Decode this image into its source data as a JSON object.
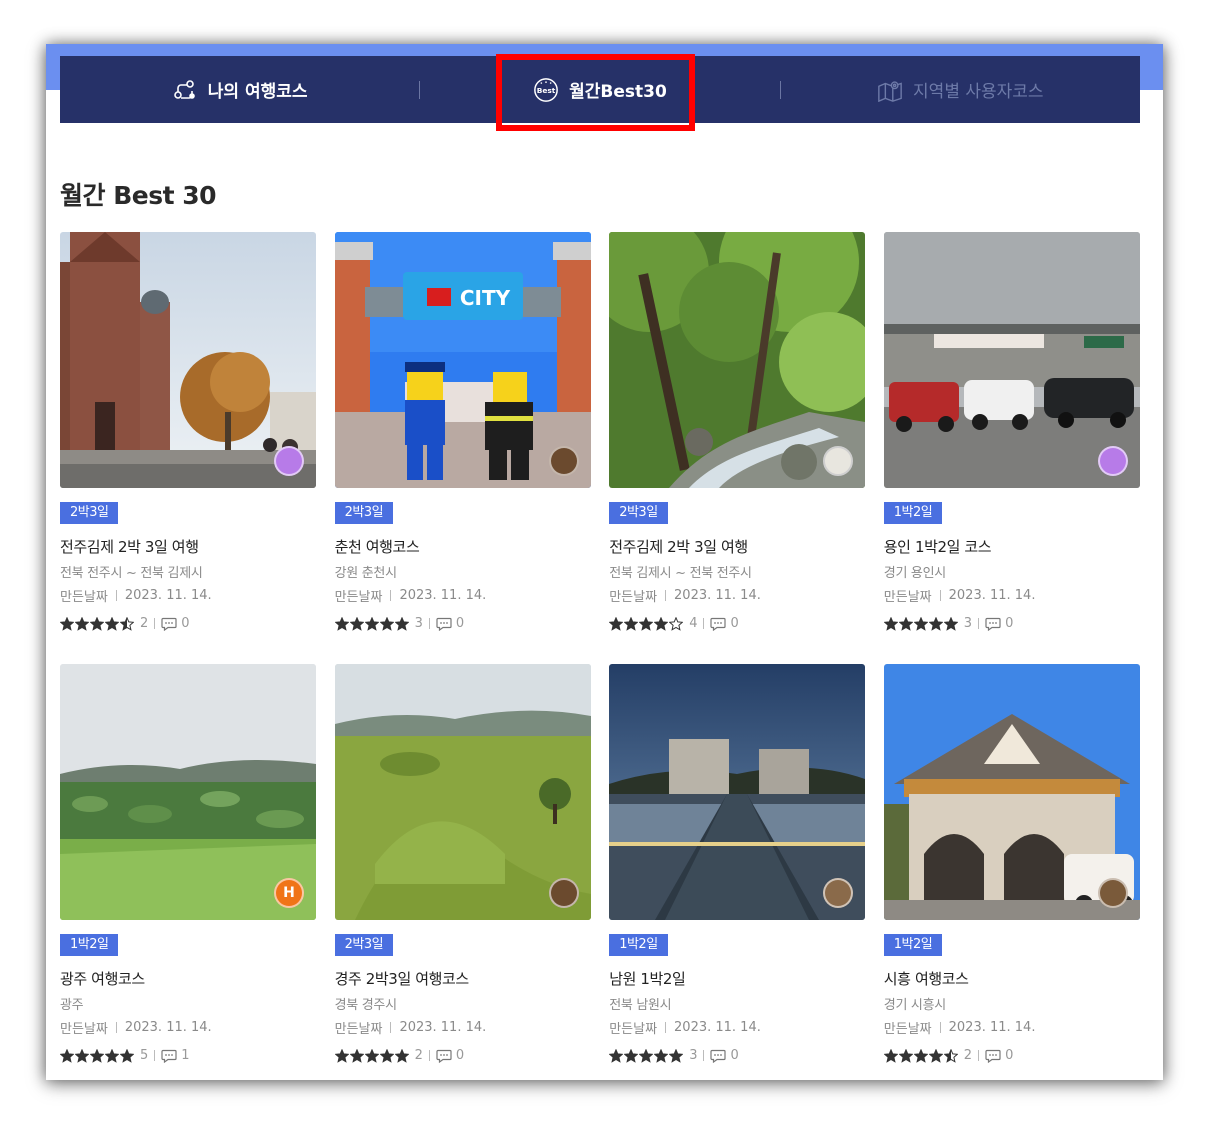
{
  "tabs": [
    {
      "label": "나의 여행코스",
      "icon": "route-icon",
      "active": false
    },
    {
      "label": "월간Best30",
      "icon": "best-badge-icon",
      "active": true
    },
    {
      "label": "지역별 사용자코스",
      "icon": "map-pin-icon",
      "active": false
    }
  ],
  "section_title": "월간 Best 30",
  "created_label": "만든날짜",
  "cards": [
    {
      "badge": "2박3일",
      "title": "전주김제 2박 3일 여행",
      "region": "전북 전주시 ~ 전북 김제시",
      "date": "2023. 11. 14.",
      "rating": 4.5,
      "rating_count": "2",
      "comments": "0",
      "avatar": "purple-avatar"
    },
    {
      "badge": "2박3일",
      "title": "춘천 여행코스",
      "region": "강원 춘천시",
      "date": "2023. 11. 14.",
      "rating": 5,
      "rating_count": "3",
      "comments": "0",
      "avatar": "photo-avatar"
    },
    {
      "badge": "2박3일",
      "title": "전주김제 2박 3일 여행",
      "region": "전북 김제시 ~ 전북 전주시",
      "date": "2023. 11. 14.",
      "rating": 4,
      "rating_count": "4",
      "comments": "0",
      "avatar": "sketch-avatar"
    },
    {
      "badge": "1박2일",
      "title": "용인 1박2일 코스",
      "region": "경기 용인시",
      "date": "2023. 11. 14.",
      "rating": 5,
      "rating_count": "3",
      "comments": "0",
      "avatar": "purple-avatar"
    },
    {
      "badge": "1박2일",
      "title": "광주 여행코스",
      "region": "광주",
      "date": "2023. 11. 14.",
      "rating": 5,
      "rating_count": "5",
      "comments": "1",
      "avatar": "letter-avatar",
      "avatar_letter": "H"
    },
    {
      "badge": "2박3일",
      "title": "경주 2박3일 여행코스",
      "region": "경북 경주시",
      "date": "2023. 11. 14.",
      "rating": 5,
      "rating_count": "2",
      "comments": "0",
      "avatar": "photo-avatar"
    },
    {
      "badge": "1박2일",
      "title": "남원 1박2일",
      "region": "전북 남원시",
      "date": "2023. 11. 14.",
      "rating": 5,
      "rating_count": "3",
      "comments": "0",
      "avatar": "photo-avatar"
    },
    {
      "badge": "1박2일",
      "title": "시흥 여행코스",
      "region": "경기 시흥시",
      "date": "2023. 11. 14.",
      "rating": 4.5,
      "rating_count": "2",
      "comments": "0",
      "avatar": "photo-avatar"
    }
  ],
  "colors": {
    "tabbar_bg": "#263168",
    "badge_bg": "#4a6fe0",
    "highlight": "#ff0000"
  }
}
